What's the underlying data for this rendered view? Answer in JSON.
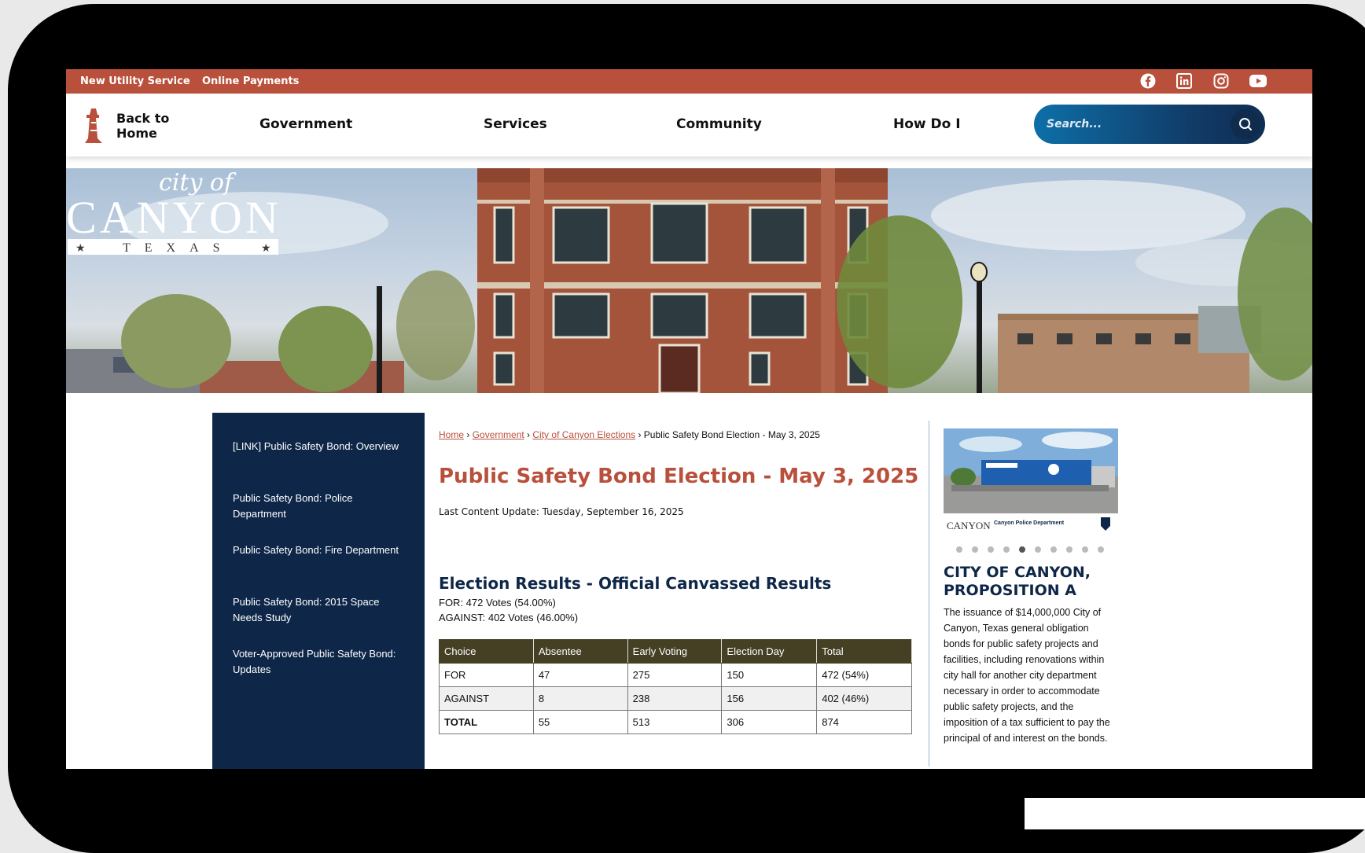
{
  "utility_bar": {
    "links": [
      "New Utility Service",
      "Online Payments"
    ],
    "social_icons": [
      "facebook-icon",
      "linkedin-icon",
      "instagram-icon",
      "youtube-icon"
    ],
    "bar_color": "#b9503b"
  },
  "header": {
    "back_home_label": "Back to Home",
    "nav": [
      "Government",
      "Services",
      "Community",
      "How Do I"
    ],
    "search_placeholder": "Search..."
  },
  "hero": {
    "logo_script": "city of",
    "logo_name": "CANYON",
    "logo_state": "TEXAS"
  },
  "sidebar": {
    "items": [
      "[LINK] Public Safety Bond: Overview",
      "Public Safety Bond: Police Department",
      "Public Safety Bond: Fire Department",
      "Public Safety Bond: 2015 Space Needs Study",
      "Voter-Approved Public Safety Bond: Updates"
    ],
    "background": "#0e2748"
  },
  "main": {
    "breadcrumb": {
      "links": [
        "Home",
        "Government",
        "City of Canyon Elections"
      ],
      "current": "Public Safety Bond Election - May 3, 2025"
    },
    "title": "Public Safety Bond Election - May 3, 2025",
    "last_update": "Last Content Update: Tuesday, September 16, 2025",
    "results_heading": "Election Results - Official Canvassed Results",
    "for_line": "FOR: 472 Votes (54.00%)",
    "against_line": "AGAINST: 402 Votes (46.00%)",
    "table": {
      "headers": [
        "Choice",
        "Absentee",
        "Early Voting",
        "Election Day",
        "Total"
      ],
      "rows": [
        [
          "FOR",
          "47",
          "275",
          "150",
          "472 (54%)"
        ],
        [
          "AGAINST",
          "8",
          "238",
          "156",
          "402 (46%)"
        ],
        [
          "TOTAL",
          "55",
          "513",
          "306",
          "874"
        ]
      ]
    }
  },
  "right": {
    "promo_caption": "Canyon Police Department",
    "slide_count": 10,
    "active_slide": 5,
    "prop_title": "CITY OF CANYON, PROPOSITION A",
    "prop_body": "The issuance of $14,000,000 City of Canyon, Texas general obligation bonds for public safety projects and facilities, including renovations within city hall for another city department necessary in order to accommodate public safety projects, and the imposition of a tax sufficient to pay the principal of and interest on the bonds."
  }
}
